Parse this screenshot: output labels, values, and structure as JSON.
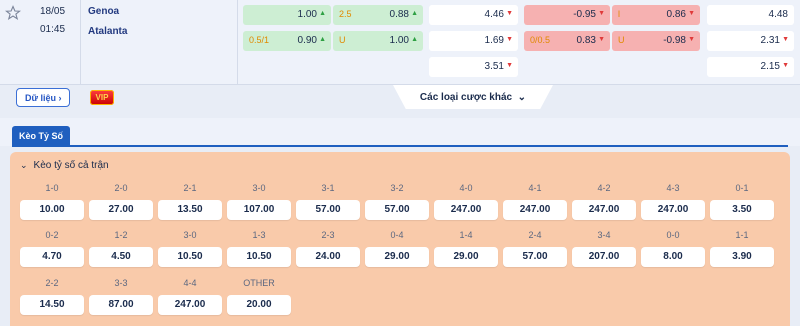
{
  "match": {
    "date": "18/05",
    "time": "01:45",
    "home": "Genoa",
    "away": "Atalanta"
  },
  "odds_rows": [
    {
      "hdp_home": "1.00",
      "ou_label": "2.5",
      "ou_over": "0.88",
      "x12_home": "4.46",
      "h1_home": "-0.95",
      "h1_ou": "l",
      "h1_over": "0.86",
      "h1_x12": "4.48"
    },
    {
      "hdp_label": "0.5/1",
      "hdp_away": "0.90",
      "ou_label2": "U",
      "ou_under": "1.00",
      "x12_away": "1.69",
      "h1_hdp_label": "0/0.5",
      "h1_away": "0.83",
      "h1_ou2": "U",
      "h1_under": "-0.98",
      "h1_x12b": "2.31"
    },
    {
      "x12_draw": "3.51",
      "h1_x12c": "2.15"
    }
  ],
  "buttons": {
    "data_label": "Dữ liệu",
    "vip_label": "VIP",
    "more_label": "Các loại cược khác"
  },
  "tab": {
    "label": "Kèo Tỷ Số"
  },
  "panel": {
    "title": "Kèo tỷ số cả trận"
  },
  "scores": [
    {
      "s": "1-0",
      "o": "10.00"
    },
    {
      "s": "2-0",
      "o": "27.00"
    },
    {
      "s": "2-1",
      "o": "13.50"
    },
    {
      "s": "3-0",
      "o": "107.00"
    },
    {
      "s": "3-1",
      "o": "57.00"
    },
    {
      "s": "3-2",
      "o": "57.00"
    },
    {
      "s": "4-0",
      "o": "247.00"
    },
    {
      "s": "4-1",
      "o": "247.00"
    },
    {
      "s": "4-2",
      "o": "247.00"
    },
    {
      "s": "4-3",
      "o": "247.00"
    },
    {
      "s": "0-1",
      "o": "3.50"
    },
    {
      "s": "0-2",
      "o": "4.70"
    },
    {
      "s": "1-2",
      "o": "4.50"
    },
    {
      "s": "3-0",
      "o": "10.50"
    },
    {
      "s": "1-3",
      "o": "10.50"
    },
    {
      "s": "2-3",
      "o": "24.00"
    },
    {
      "s": "0-4",
      "o": "29.00"
    },
    {
      "s": "1-4",
      "o": "29.00"
    },
    {
      "s": "2-4",
      "o": "57.00"
    },
    {
      "s": "3-4",
      "o": "207.00"
    },
    {
      "s": "0-0",
      "o": "8.00"
    },
    {
      "s": "1-1",
      "o": "3.90"
    },
    {
      "s": "2-2",
      "o": "14.50"
    },
    {
      "s": "3-3",
      "o": "87.00"
    },
    {
      "s": "4-4",
      "o": "247.00"
    },
    {
      "s": "OTHER",
      "o": "20.00"
    }
  ]
}
